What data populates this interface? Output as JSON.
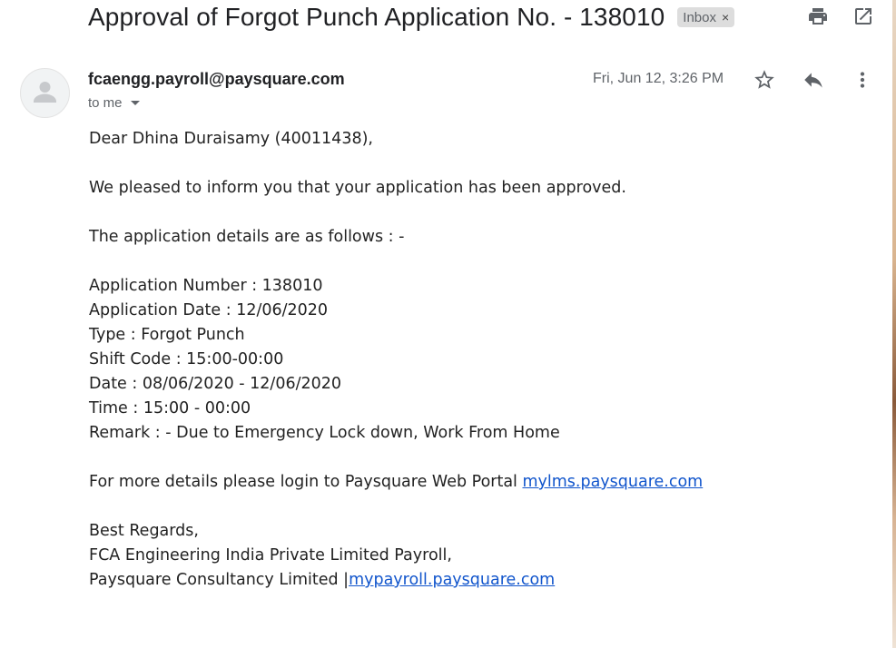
{
  "email": {
    "subject": "Approval of Forgot Punch Application No. - 138010",
    "label": "Inbox",
    "label_remove": "×",
    "sender": "fcaengg.payroll@paysquare.com",
    "recipient": "to me",
    "date": "Fri, Jun 12, 3:26 PM"
  },
  "body": {
    "greeting": "Dear Dhina Duraisamy (40011438),",
    "line1": "We pleased to inform you that your application has been approved.",
    "line2": "The application details are as follows : -",
    "details": [
      "Application Number : 138010",
      "Application Date : 12/06/2020",
      "Type : Forgot Punch",
      "Shift Code : 15:00-00:00",
      "Date : 08/06/2020 - 12/06/2020",
      "Time : 15:00 - 00:00",
      "Remark : - Due to Emergency Lock down, Work From Home"
    ],
    "portal_text": "For more details please login to Paysquare Web Portal ",
    "portal_link": "mylms.paysquare.com",
    "sign_off": "Best Regards,",
    "company": "FCA Engineering India Private Limited Payroll,",
    "consultancy": "Paysquare Consultancy Limited |",
    "consultancy_link": "mypayroll.paysquare.com"
  },
  "icons": {
    "print": "printer-icon",
    "open_new_window": "open-in-new-icon",
    "star": "star-icon",
    "reply": "reply-icon",
    "more": "more-vert-icon",
    "avatar": "default-avatar-icon"
  },
  "colors": {
    "link": "#1155cc",
    "text": "#222222",
    "secondary": "#5f6368",
    "chip_bg": "#dddddd"
  }
}
